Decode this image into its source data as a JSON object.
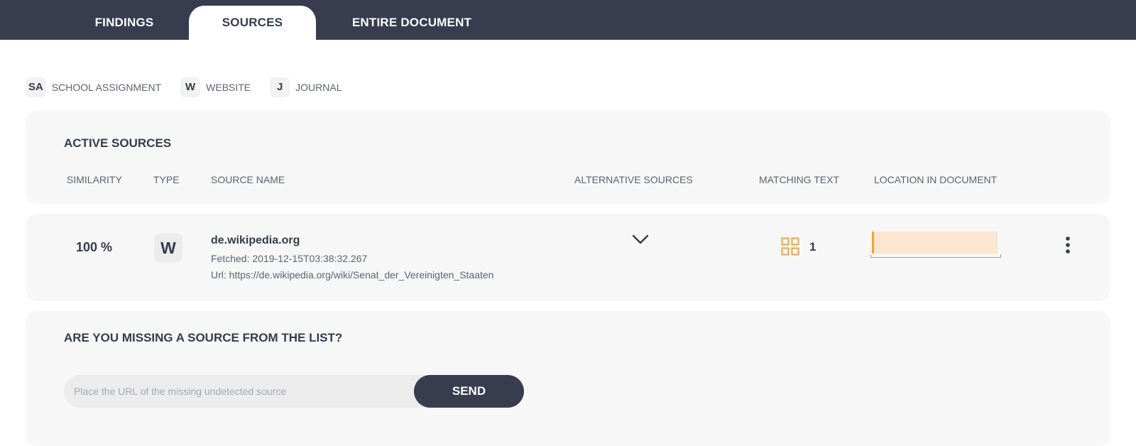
{
  "tabs": {
    "findings": "FINDINGS",
    "sources": "SOURCES",
    "entire_document": "ENTIRE DOCUMENT",
    "active": "SOURCES"
  },
  "legend": [
    {
      "badge": "SA",
      "label": "SCHOOL ASSIGNMENT"
    },
    {
      "badge": "W",
      "label": "WEBSITE"
    },
    {
      "badge": "J",
      "label": "JOURNAL"
    }
  ],
  "active_sources": {
    "title": "ACTIVE SOURCES",
    "columns": {
      "similarity": "SIMILARITY",
      "type": "TYPE",
      "source_name": "SOURCE NAME",
      "alternative_sources": "ALTERNATIVE SOURCES",
      "matching_text": "MATCHING TEXT",
      "location": "LOCATION IN DOCUMENT"
    },
    "rows": [
      {
        "similarity": "100 %",
        "type_badge": "W",
        "name": "de.wikipedia.org",
        "fetched": "Fetched: 2019-12-15T03:38:32.267",
        "url": "Url: https://de.wikipedia.org/wiki/Senat_der_Vereinigten_Staaten",
        "alternative_icon": "chevron-down-icon",
        "matching_icon": "grid-icon",
        "matching_count": "1",
        "location_fraction": 0.96,
        "menu_icon": "kebab-menu-icon"
      }
    ]
  },
  "missing_source": {
    "title": "ARE YOU MISSING A SOURCE FROM THE LIST?",
    "input_placeholder": "Place the URL of the missing undetected source",
    "input_value": "",
    "send_label": "SEND"
  },
  "colors": {
    "header_bg": "#373d4e",
    "card_bg": "#f7f7f7",
    "accent_orange": "#f2a33a",
    "location_fill": "#fbe7cf",
    "text_dark": "#353c4c"
  }
}
